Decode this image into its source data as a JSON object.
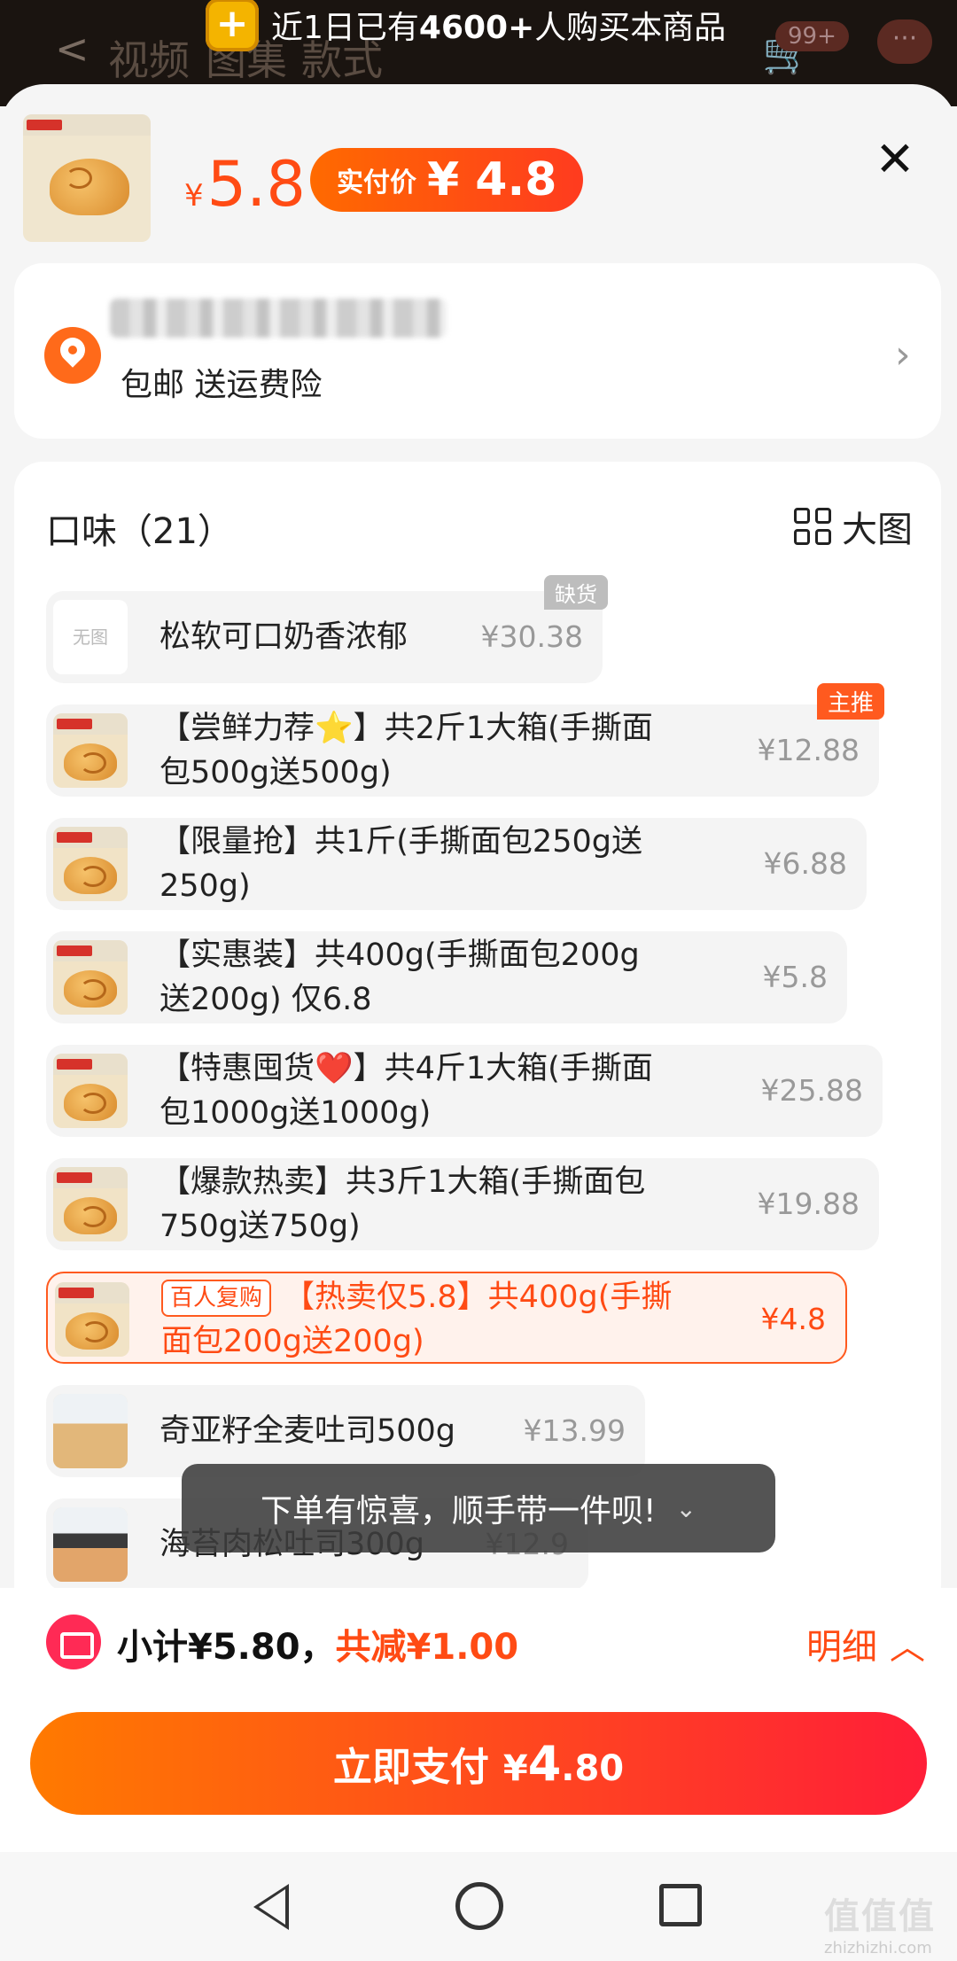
{
  "background": {
    "banner_prefix": "近1日已有",
    "banner_count": "4600+",
    "banner_suffix": "人购买本商品",
    "nav_tabs": [
      "视频",
      "图集",
      "款式"
    ],
    "cart_badge": "99+",
    "more_label": "···"
  },
  "header": {
    "price_currency": "¥",
    "price": "5.8",
    "paid_label": "实付价",
    "paid_currency": "¥",
    "paid_price": "4.8",
    "close_icon": "close-icon"
  },
  "address": {
    "subtitle": "包邮 送运费险"
  },
  "options": {
    "title": "口味（21）",
    "big_image_label": "大图",
    "items": [
      {
        "name": "松软可口奶香浓郁",
        "price": "¥30.38",
        "tag": "缺货",
        "thumb": "无图"
      },
      {
        "name_line1": "【尝鲜力荐⭐】共2斤1大箱(手撕面",
        "name_line2": "包500g送500g)",
        "price": "¥12.88",
        "tag": "主推"
      },
      {
        "name_line1": "【限量抢】共1斤(手撕面包250g送",
        "name_line2": "250g)",
        "price": "¥6.88"
      },
      {
        "name_line1": "【实惠装】共400g(手撕面包200g",
        "name_line2": "送200g) 仅6.8",
        "price": "¥5.8"
      },
      {
        "name_line1": "【特惠囤货❤️】共4斤1大箱(手撕面",
        "name_line2": "包1000g送1000g)",
        "price": "¥25.88"
      },
      {
        "name_line1": "【爆款热卖】共3斤1大箱(手撕面包",
        "name_line2": "750g送750g)",
        "price": "¥19.88"
      },
      {
        "badge": "百人复购",
        "name_line1": "【热卖仅5.8】共400g(手撕",
        "name_line2": "面包200g送200g)",
        "price": "¥4.8",
        "selected": true
      },
      {
        "name": "奇亚籽全麦吐司500g",
        "price": "¥13.99"
      },
      {
        "name": "海苔肉松吐司300g",
        "price": "¥12.9"
      }
    ]
  },
  "toast": {
    "text": "下单有惊喜，顺手带一件呗!",
    "icon": "double-chevron-down-icon"
  },
  "footer": {
    "subtotal": "小计¥5.80，",
    "discount": "共减¥1.00",
    "detail_label": "明细",
    "pay_label": "立即支付",
    "pay_currency": "¥",
    "pay_amount_int": "4",
    "pay_amount_dec": ".80"
  },
  "watermark": {
    "text": "值值值",
    "url": "zhizhizhi.com"
  },
  "colors": {
    "accent": "#ff4b14",
    "pay_start": "#ff7a00",
    "pay_end": "#ff1e38"
  }
}
